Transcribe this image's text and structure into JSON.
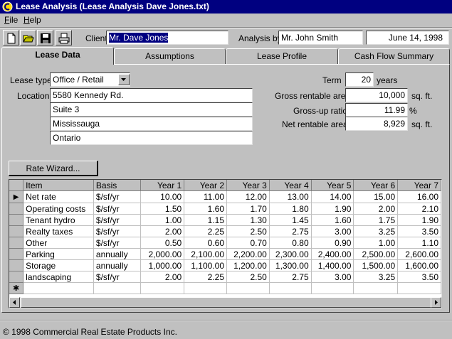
{
  "window": {
    "title": "Lease Analysis  (Lease Analysis Dave Jones.txt)",
    "app_icon": "lease-app-icon"
  },
  "menu": [
    {
      "label": "File",
      "mnemonic": "F",
      "rest": "ile"
    },
    {
      "label": "Help",
      "mnemonic": "H",
      "rest": "elp"
    }
  ],
  "toolbar": {
    "icons": [
      "new-document-icon",
      "open-folder-icon",
      "save-disk-icon",
      "print-icon"
    ],
    "client_label": "Client",
    "client_value": "Mr. Dave Jones",
    "analysis_by_label": "Analysis by",
    "analysis_by_value": "Mr. John Smith",
    "date_value": "June 14, 1998"
  },
  "tabs": [
    {
      "label": "Lease Data",
      "active": true
    },
    {
      "label": "Assumptions",
      "active": false
    },
    {
      "label": "Lease Profile",
      "active": false
    },
    {
      "label": "Cash Flow Summary",
      "active": false
    }
  ],
  "lease": {
    "type_label": "Lease type",
    "type_value": "Office / Retail",
    "location_label": "Location",
    "location_lines": [
      "5580 Kennedy Rd.",
      "Suite 3",
      "Mississauga",
      "Ontario"
    ],
    "term_label": "Term",
    "term_value": "20",
    "term_unit": "years",
    "gross_label": "Gross rentable area",
    "gross_value": "10,000",
    "gross_unit": "sq. ft.",
    "grossup_label": "Gross-up ratio",
    "grossup_value": "11.99",
    "grossup_unit": "%",
    "net_label": "Net rentable area",
    "net_value": "8,929",
    "net_unit": "sq. ft."
  },
  "rate_wizard_label": "Rate Wizard...",
  "grid": {
    "columns": [
      "Item",
      "Basis",
      "Year 1",
      "Year 2",
      "Year 3",
      "Year 4",
      "Year 5",
      "Year 6",
      "Year 7"
    ],
    "rows": [
      [
        "Net rate",
        "$/sf/yr",
        "10.00",
        "11.00",
        "12.00",
        "13.00",
        "14.00",
        "15.00",
        "16.00"
      ],
      [
        "Operating costs",
        "$/sf/yr",
        "1.50",
        "1.60",
        "1.70",
        "1.80",
        "1.90",
        "2.00",
        "2.10"
      ],
      [
        "Tenant hydro",
        "$/sf/yr",
        "1.00",
        "1.15",
        "1.30",
        "1.45",
        "1.60",
        "1.75",
        "1.90"
      ],
      [
        "Realty taxes",
        "$/sf/yr",
        "2.00",
        "2.25",
        "2.50",
        "2.75",
        "3.00",
        "3.25",
        "3.50"
      ],
      [
        "Other",
        "$/sf/yr",
        "0.50",
        "0.60",
        "0.70",
        "0.80",
        "0.90",
        "1.00",
        "1.10"
      ],
      [
        "Parking",
        "annually",
        "2,000.00",
        "2,100.00",
        "2,200.00",
        "2,300.00",
        "2,400.00",
        "2,500.00",
        "2,600.00"
      ],
      [
        "Storage",
        "annually",
        "1,000.00",
        "1,100.00",
        "1,200.00",
        "1,300.00",
        "1,400.00",
        "1,500.00",
        "1,600.00"
      ],
      [
        "landscaping",
        "$/sf/yr",
        "2.00",
        "2.25",
        "2.50",
        "2.75",
        "3.00",
        "3.25",
        "3.50"
      ]
    ],
    "current_row_marker": "▶",
    "new_row_marker": "✱"
  },
  "status": "© 1998 Commercial Real Estate Products Inc."
}
